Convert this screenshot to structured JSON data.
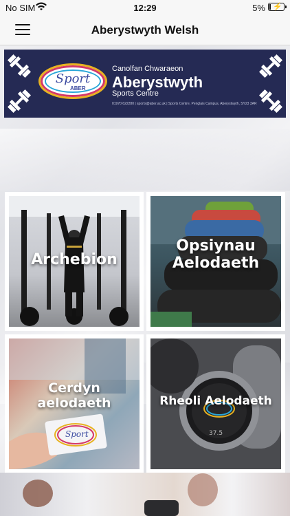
{
  "status_bar": {
    "carrier": "No SIM",
    "time": "12:29",
    "battery": "5%"
  },
  "nav": {
    "title": "Aberystwyth Welsh",
    "menu_icon": "hamburger-menu-icon"
  },
  "banner": {
    "logo_text": "Sport",
    "logo_sub": "ABER",
    "line1": "Canolfan Chwaraeon",
    "line2": "Aberystwyth",
    "line3": "Sports Centre",
    "line4": "01970 622280 | sports@aber.ac.uk | Sports Centre, Penglais Campus, Aberystwyth, SY23 3AR"
  },
  "tiles": [
    {
      "label": "Archebion"
    },
    {
      "label": "Opsiynau Aelodaeth"
    },
    {
      "label": "Cerdyn aelodaeth"
    },
    {
      "label": "Rheoli Aelodaeth"
    }
  ],
  "colors": {
    "banner_bg": "#252a54",
    "logo_yellow": "#e8b221",
    "logo_pink": "#d4386a",
    "logo_blue": "#2aa7d8"
  }
}
